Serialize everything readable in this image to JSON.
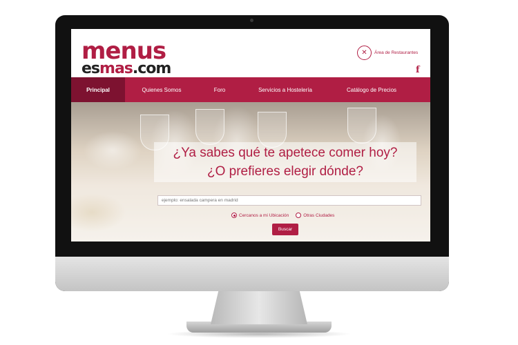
{
  "header": {
    "logo_line1": "menus",
    "logo_line2_a": "es",
    "logo_line2_b": "mas",
    "logo_line2_c": ".com",
    "restaurant_area_label": "Área de Restaurantes"
  },
  "nav": {
    "items": [
      {
        "label": "Principal"
      },
      {
        "label": "Quienes Somos"
      },
      {
        "label": "Foro"
      },
      {
        "label": "Servicios a Hostelería"
      },
      {
        "label": "Catálogo de Precios"
      }
    ]
  },
  "hero": {
    "headline_line1": "¿Ya sabes qué te apetece comer hoy?",
    "headline_line2": "¿O prefieres elegir dónde?",
    "search_placeholder": "ejemplo: ensalada campera en madrid",
    "radio_near": "Cercanos a mi Ubicación",
    "radio_other": "Otras Ciudades",
    "radio_near_selected": true,
    "search_button": "Buscar"
  },
  "colors": {
    "brand": "#b01e44",
    "brand_dark": "#7d1230"
  }
}
